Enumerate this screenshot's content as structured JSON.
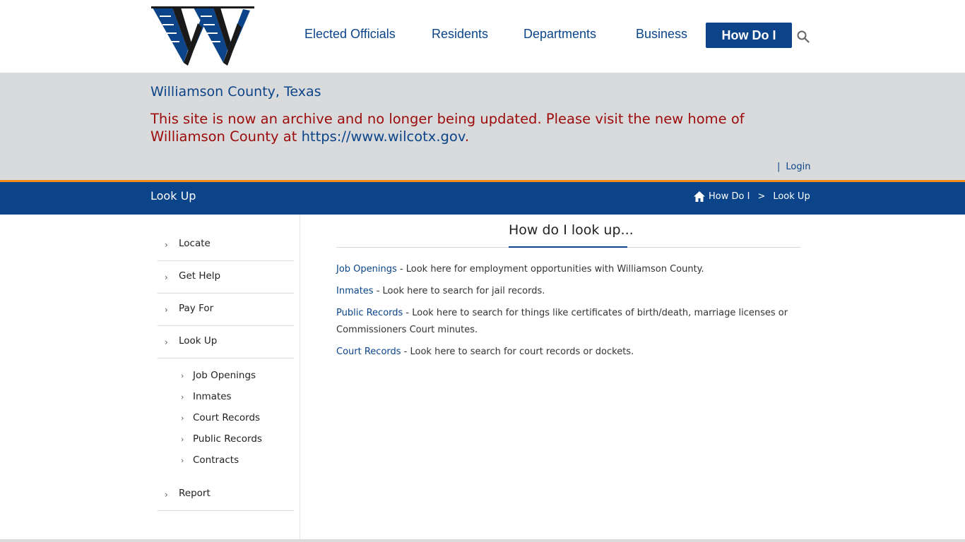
{
  "header": {
    "logo_alt": "W",
    "nav": [
      {
        "label": "Elected Officials"
      },
      {
        "label": "Residents"
      },
      {
        "label": "Departments"
      },
      {
        "label": "Business"
      }
    ],
    "nav_active": {
      "label": "How Do I"
    }
  },
  "notice": {
    "title": "Williamson County, Texas",
    "message": "This site is now an archive and no longer being updated. Please visit the new home of Williamson County at ",
    "link": "https://www.wilcotx.gov",
    "end": ".",
    "separator": "|",
    "login": "Login"
  },
  "titlebar": {
    "title": "Look Up",
    "breadcrumb": [
      {
        "label": "How Do I"
      },
      {
        "label": "Look Up"
      }
    ],
    "separator": ">"
  },
  "sidebar": {
    "items": [
      {
        "label": "Locate"
      },
      {
        "label": "Get Help"
      },
      {
        "label": "Pay For"
      },
      {
        "label": "Look Up"
      },
      {
        "label": "Report"
      }
    ],
    "subitems": [
      {
        "label": "Job Openings"
      },
      {
        "label": "Inmates"
      },
      {
        "label": "Court Records"
      },
      {
        "label": "Public Records"
      },
      {
        "label": "Contracts"
      }
    ]
  },
  "content": {
    "heading": "How do I look up...",
    "entries": [
      {
        "link": "Job Openings",
        "text": " - Look here for employment opportunities with Williamson County."
      },
      {
        "link": "Inmates",
        "text": " - Look here to search for jail records."
      },
      {
        "link": "Public Records",
        "text": " - Look here to search for things like certificates of birth/death, marriage licenses or Commissioners Court minutes."
      },
      {
        "link": "Court Records",
        "text": " - Look here to search for court records or dockets."
      }
    ]
  },
  "colors": {
    "brand_blue": "#0b4488",
    "accent_orange": "#f18c1c",
    "notice_red": "#9c0b0b",
    "notice_bg": "#d9dadc"
  }
}
